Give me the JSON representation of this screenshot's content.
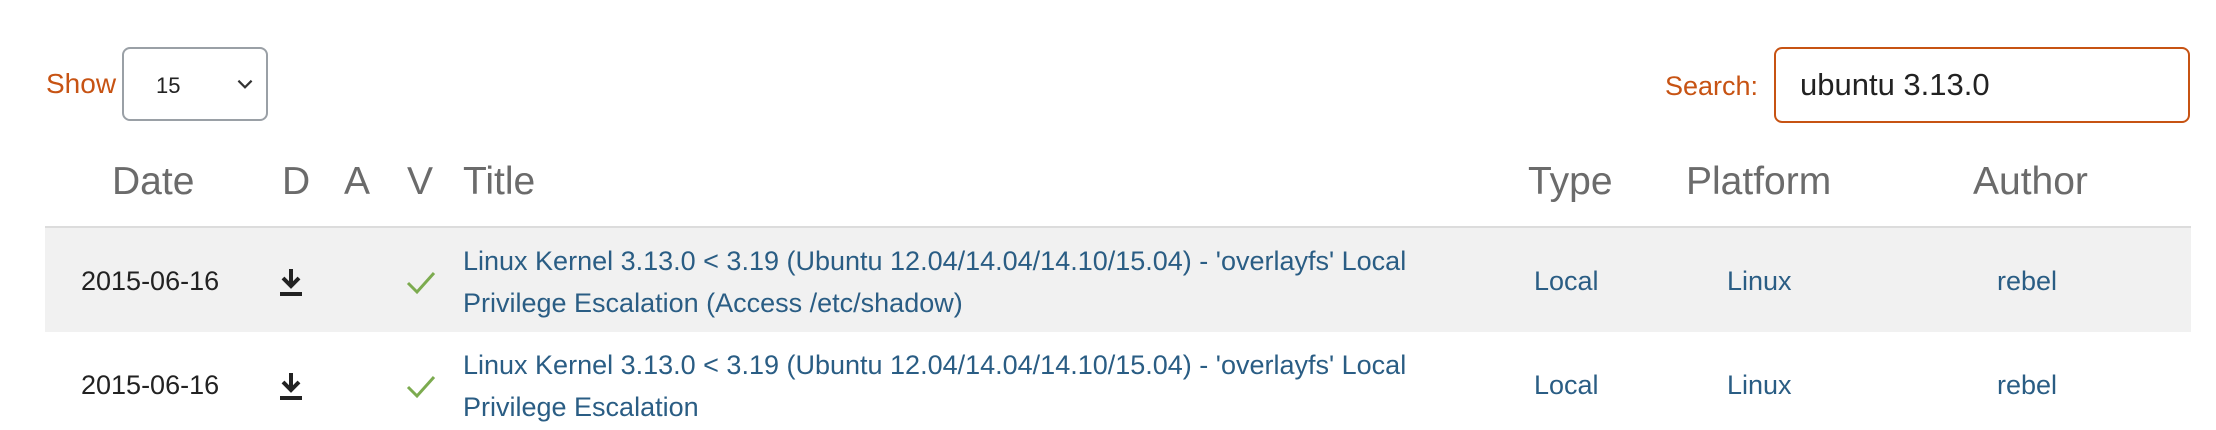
{
  "controls": {
    "show_label": "Show",
    "show_value": "15",
    "search_label": "Search:",
    "search_value": "ubuntu 3.13.0"
  },
  "table": {
    "headers": {
      "date": "Date",
      "d": "D",
      "a": "A",
      "v": "V",
      "title": "Title",
      "type": "Type",
      "platform": "Platform",
      "author": "Author"
    },
    "rows": [
      {
        "date": "2015-06-16",
        "download": "download-icon",
        "verified": "check-icon",
        "title_line1": "Linux Kernel 3.13.0 < 3.19 (Ubuntu 12.04/14.04/14.10/15.04) - 'overlayfs' Local",
        "title_line2": "Privilege Escalation (Access /etc/shadow)",
        "type": "Local",
        "platform": "Linux",
        "author": "rebel"
      },
      {
        "date": "2015-06-16",
        "download": "download-icon",
        "verified": "check-icon",
        "title_line1": "Linux Kernel 3.13.0 < 3.19 (Ubuntu 12.04/14.04/14.10/15.04) - 'overlayfs' Local",
        "title_line2": "Privilege Escalation",
        "type": "Local",
        "platform": "Linux",
        "author": "rebel"
      }
    ]
  },
  "colors": {
    "accent": "#c75313",
    "link": "#2a5d84",
    "check": "#7cab4f",
    "row_stripe": "#f1f1f1"
  }
}
